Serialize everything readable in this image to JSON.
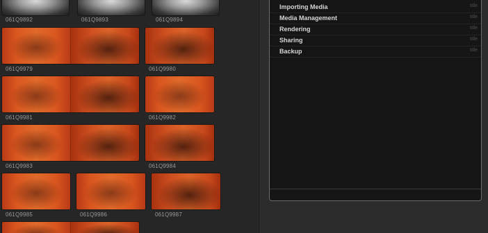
{
  "browser": {
    "clips": [
      {
        "name": "061Q9892"
      },
      {
        "name": "061Q9893"
      },
      {
        "name": "061Q9894"
      },
      {
        "name": "061Q9979"
      },
      {
        "name": "061Q9980"
      },
      {
        "name": "061Q9981"
      },
      {
        "name": "061Q9982"
      },
      {
        "name": "061Q9983"
      },
      {
        "name": "061Q9984"
      },
      {
        "name": "061Q9985"
      },
      {
        "name": "061Q9986"
      },
      {
        "name": "061Q9987"
      }
    ]
  },
  "background_tasks": {
    "rows": [
      {
        "name": "Importing Media",
        "status": "Idle"
      },
      {
        "name": "Media Management",
        "status": "Idle"
      },
      {
        "name": "Rendering",
        "status": "Idle"
      },
      {
        "name": "Sharing",
        "status": "Idle"
      },
      {
        "name": "Backup",
        "status": "Idle"
      }
    ]
  },
  "colors": {
    "clip_orange": "#d9561f",
    "panel_background": "#151515",
    "task_label": "#d6d6d6",
    "status_text": "#4e4e4e"
  }
}
